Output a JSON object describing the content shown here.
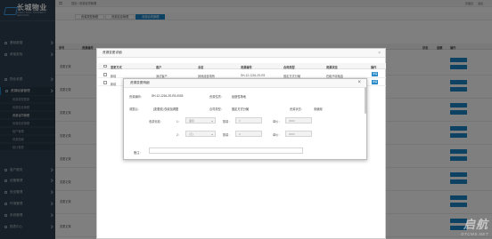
{
  "app": {
    "logo_cn": "长城物业",
    "logo_en": "GREAT WALL PROPERTY SERVICES"
  },
  "sidebar": {
    "items": [
      {
        "label": "基础数据"
      },
      {
        "label": "承接查验"
      },
      {
        "label": "物业收费"
      },
      {
        "label": "资源经营管理"
      },
      {
        "label": "客户服务"
      },
      {
        "label": "设备管理"
      },
      {
        "label": "安全管理"
      },
      {
        "label": "环境管理"
      },
      {
        "label": "系统管理"
      },
      {
        "label": "报表中心"
      }
    ],
    "sub_items": [
      {
        "label": "资源类型配置"
      },
      {
        "label": "资源信息管理"
      },
      {
        "label": "资源合同管理"
      },
      {
        "label": "资源收费管理"
      },
      {
        "label": "租户管理"
      },
      {
        "label": "资源档案"
      },
      {
        "label": "统计报表"
      }
    ]
  },
  "topbar": {
    "breadcrumb": "首页 / 资源合同管理",
    "user": "管理员",
    "logout": "退出"
  },
  "tabs": [
    "资源类型管理",
    "资源信息管理",
    "资源合同管理"
  ],
  "bg_table": {
    "headers": [
      "序号",
      "资源编号",
      "资源名称",
      "客户",
      "合同编号",
      "合同类型",
      "资源状态",
      "操作",
      "状态",
      "金额",
      "操作"
    ],
    "rows": [
      {
        "c1": "变更记录"
      },
      {
        "c1": "变更记录"
      },
      {
        "c1": "变更记录"
      },
      {
        "c1": "变更记录"
      },
      {
        "c1": "变更记录"
      },
      {
        "c1": "变更记录"
      },
      {
        "c1": "变更记录"
      },
      {
        "c1": "变更记录"
      }
    ]
  },
  "dialog1": {
    "title": "资源变更详细",
    "headers": [
      "变更方式",
      "客户",
      "业态",
      "资源编号",
      "合同类型",
      "资源状态",
      "操作"
    ],
    "rows": [
      {
        "type": "新增",
        "customer": "测试客户",
        "biz": "其他经营场所",
        "code": "SH-12-1216-2S-R3",
        "contract": "固定方式分摊",
        "status": "在租不收租金",
        "action": "详情"
      },
      {
        "type": "新增",
        "customer": "",
        "biz": "",
        "code": "",
        "contract": "",
        "status": "",
        "action": "详情"
      }
    ]
  },
  "dialog2": {
    "title": "资源变更明细",
    "fields": {
      "resource_code_label": "资源编码：",
      "resource_code": "SH-12-1216-2S-R3-0003",
      "resource_nature_label": "资源性质：",
      "resource_nature": "经营性场地",
      "adjust_label": "调整后：",
      "adjust_value": "[变更前]  仅增加调整",
      "contract_type_label": "合同类型：",
      "contract_type": "固定方式分摊",
      "status_label": "资源状态：",
      "status_value": "未使用",
      "fee_std_label": "收费标准：",
      "row1_index": "1：",
      "row1_select": "面积",
      "qty_label": "数量：",
      "row1_qty": "0",
      "price_label": "单价：",
      "row1_price": "0000",
      "row2_index": "2：",
      "row2_select": "(元)",
      "row2_qty": "0",
      "row2_price": "0000",
      "remark_label": "备注："
    }
  },
  "watermark": {
    "cn": "启航",
    "en": "DTCMS.NET"
  },
  "colors": {
    "sidebar": "#2f4050",
    "accent": "#1c84c6"
  }
}
